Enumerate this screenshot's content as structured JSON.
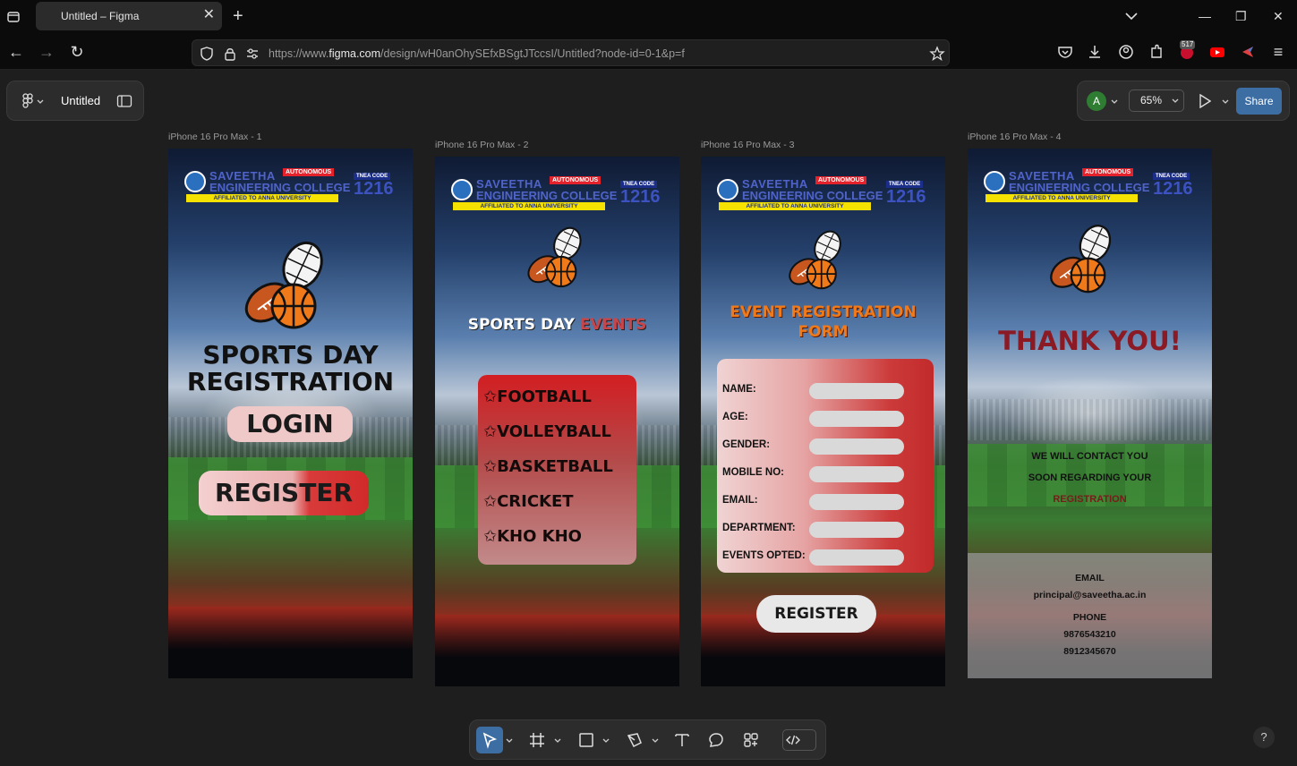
{
  "browser": {
    "tab_title": "Untitled – Figma",
    "url_prefix": "https://www.",
    "url_domain": "figma.com",
    "url_rest": "/design/wH0anOhySEfxBSgtJTccsI/Untitled?node-id=0-1&p=f",
    "ext_badge": "517"
  },
  "figma": {
    "file_name": "Untitled",
    "avatar_letter": "A",
    "zoom": "65%",
    "share_label": "Share",
    "help": "?"
  },
  "college": {
    "name_line1": "SAVEETHA",
    "name_line2": "ENGINEERING COLLEGE",
    "autonomous": "AUTONOMOUS",
    "affiliated": "AFFILIATED TO ANNA UNIVERSITY",
    "tnea": "TNEA CODE",
    "code": "1216"
  },
  "frames": [
    {
      "label": "iPhone 16 Pro Max - 1",
      "title_line1": "SPORTS DAY",
      "title_line2": "REGISTRATION",
      "login": "LOGIN",
      "register": "REGISTER"
    },
    {
      "label": "iPhone 16 Pro Max - 2",
      "title_a": "SPORTS DAY ",
      "title_b": "EVENTS",
      "events": [
        "✩FOOTBALL",
        "✩VOLLEYBALL",
        "✩BASKETBALL",
        "✩CRICKET",
        "✩KHO KHO"
      ]
    },
    {
      "label": "iPhone 16 Pro Max - 3",
      "title_line1": "EVENT REGISTRATION",
      "title_line2": "FORM",
      "fields": [
        "NAME:",
        "AGE:",
        "GENDER:",
        "MOBILE NO:",
        "EMAIL:",
        "DEPARTMENT:",
        "EVENTS OPTED:"
      ],
      "register": "REGISTER"
    },
    {
      "label": "iPhone 16 Pro Max - 4",
      "title": "THANK YOU!",
      "msg_line1": "WE WILL CONTACT YOU",
      "msg_line2": "SOON REGARDING YOUR",
      "msg_line3": "REGISTRATION",
      "email_label": "EMAIL",
      "email": "principal@saveetha.ac.in",
      "phone_label": "PHONE",
      "phone1": "9876543210",
      "phone2": "8912345670"
    }
  ]
}
